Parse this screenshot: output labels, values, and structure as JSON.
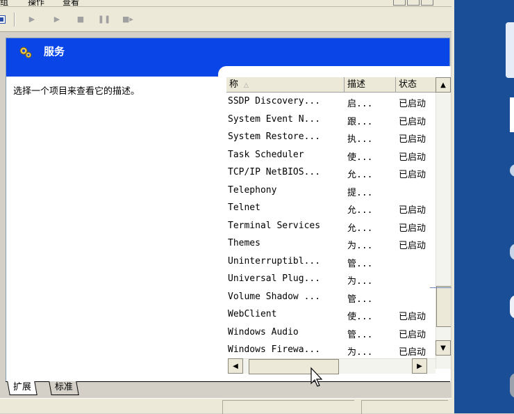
{
  "window": {
    "title": "服务",
    "description_prompt": "选择一个项目来查看它的描述。"
  },
  "menu_partial": [
    "组",
    "操作",
    "查看"
  ],
  "toolbar": {
    "buttons": [
      {
        "name": "play-icon"
      },
      {
        "name": "play-icon"
      },
      {
        "name": "stop-icon"
      },
      {
        "name": "pause-icon"
      },
      {
        "name": "restart-icon"
      }
    ]
  },
  "list": {
    "columns": {
      "name": "称",
      "description": "描述",
      "status": "状态"
    },
    "rows": [
      {
        "name": "SSDP Discovery...",
        "desc": "启...",
        "status": "已启动"
      },
      {
        "name": "System Event N...",
        "desc": "跟...",
        "status": "已启动"
      },
      {
        "name": "System Restore...",
        "desc": "执...",
        "status": "已启动"
      },
      {
        "name": "Task Scheduler",
        "desc": "使...",
        "status": "已启动"
      },
      {
        "name": "TCP/IP NetBIOS...",
        "desc": "允...",
        "status": "已启动"
      },
      {
        "name": "Telephony",
        "desc": "提...",
        "status": ""
      },
      {
        "name": "Telnet",
        "desc": "允...",
        "status": "已启动"
      },
      {
        "name": "Terminal Services",
        "desc": "允...",
        "status": "已启动"
      },
      {
        "name": "Themes",
        "desc": "为...",
        "status": "已启动"
      },
      {
        "name": "Uninterruptibl...",
        "desc": "管...",
        "status": ""
      },
      {
        "name": "Universal Plug...",
        "desc": "为...",
        "status": ""
      },
      {
        "name": "Volume Shadow ...",
        "desc": "管...",
        "status": ""
      },
      {
        "name": "WebClient",
        "desc": "使...",
        "status": "已启动"
      },
      {
        "name": "Windows Audio",
        "desc": "管...",
        "status": "已启动"
      },
      {
        "name": "Windows Firewa...",
        "desc": "为...",
        "status": "已启动"
      }
    ]
  },
  "tabs": [
    {
      "label": "扩展",
      "active": true
    },
    {
      "label": "标准",
      "active": false
    }
  ],
  "colors": {
    "header_band": "#0a45e8",
    "desktop": "#1a4f97",
    "chrome": "#ece9d8"
  }
}
